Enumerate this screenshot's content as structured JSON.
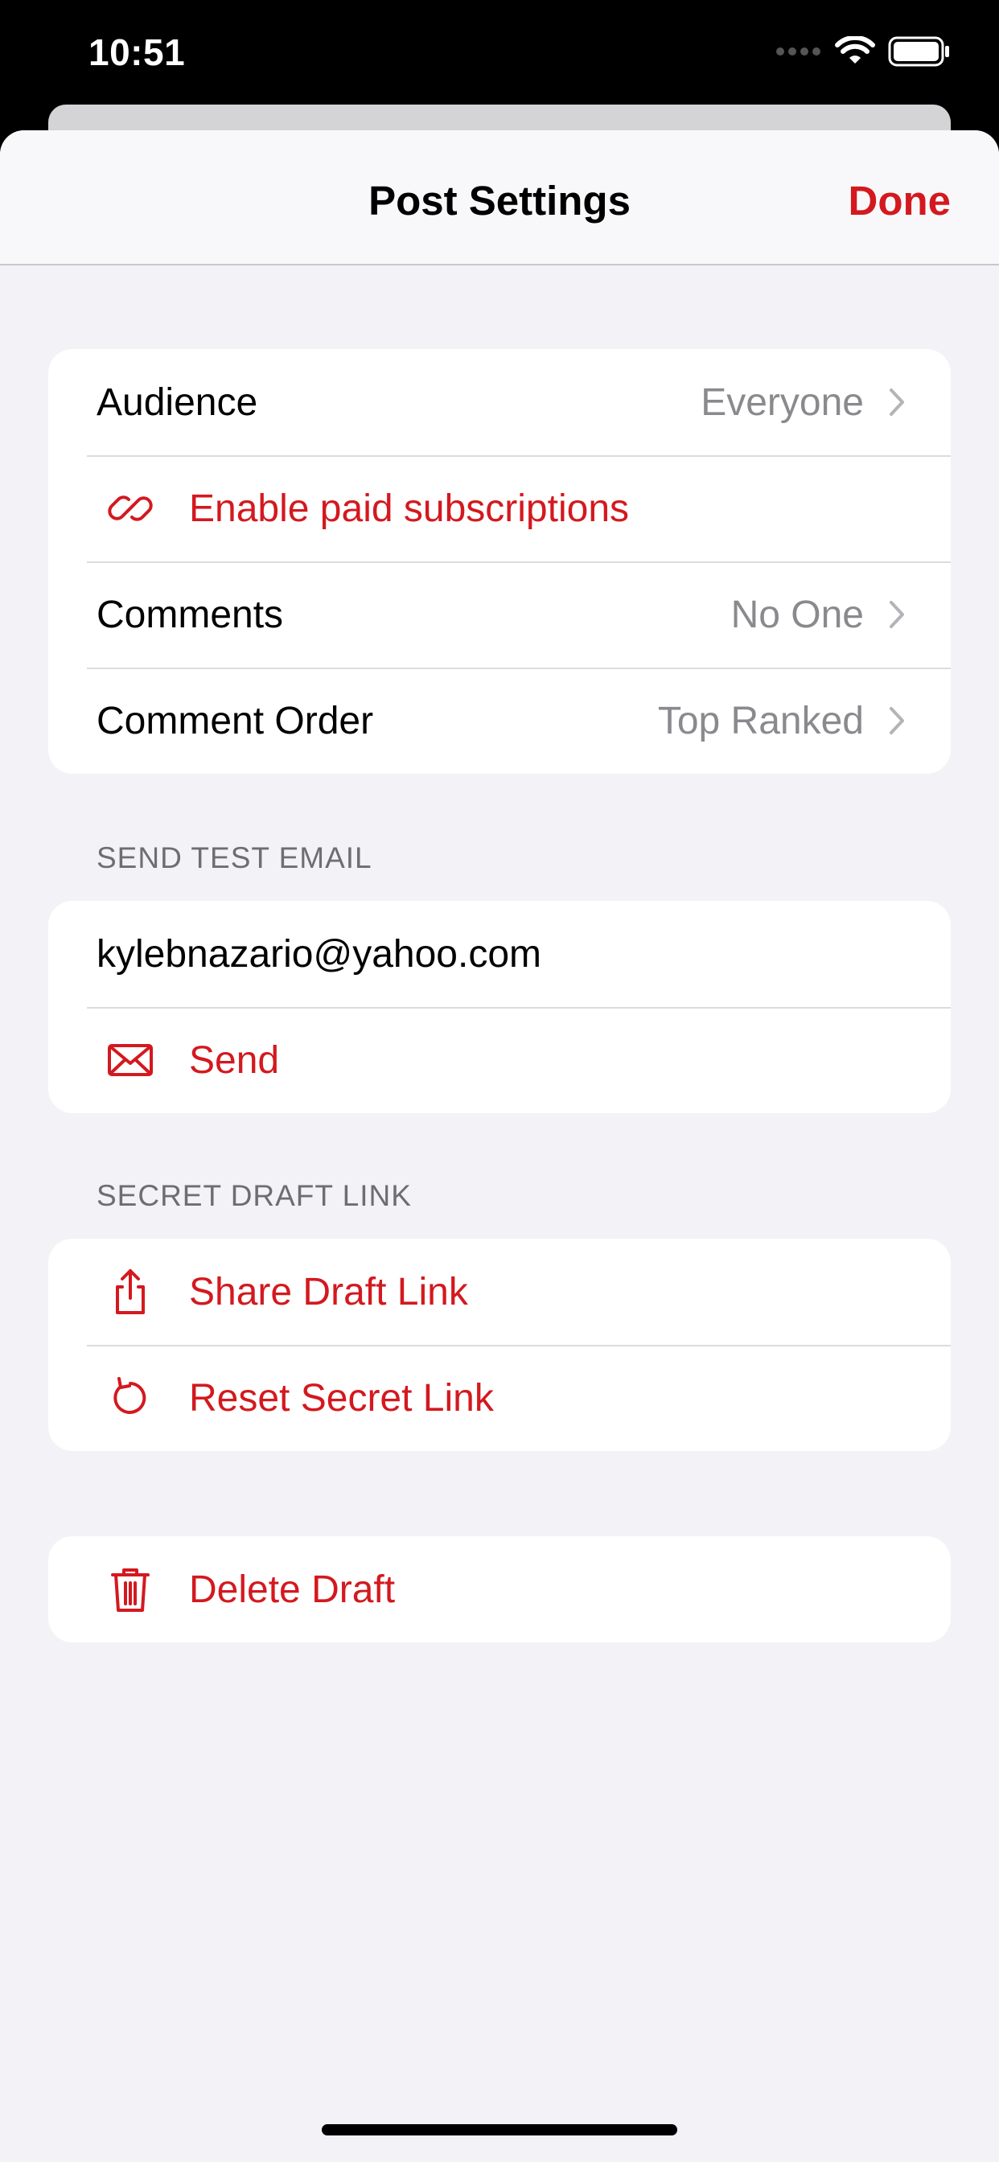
{
  "status_bar": {
    "time": "10:51"
  },
  "nav": {
    "title": "Post Settings",
    "done_label": "Done"
  },
  "settings": {
    "audience": {
      "label": "Audience",
      "value": "Everyone"
    },
    "paid": {
      "label": "Enable paid subscriptions"
    },
    "comments": {
      "label": "Comments",
      "value": "No One"
    },
    "comment_order": {
      "label": "Comment Order",
      "value": "Top Ranked"
    }
  },
  "test_email": {
    "header": "SEND TEST EMAIL",
    "email_value": "kylebnazario@yahoo.com",
    "send_label": "Send"
  },
  "draft_link": {
    "header": "SECRET DRAFT LINK",
    "share_label": "Share Draft Link",
    "reset_label": "Reset Secret Link"
  },
  "danger": {
    "delete_label": "Delete Draft"
  },
  "colors": {
    "accent": "#d3191f",
    "background": "#f2f2f7",
    "secondary_text": "#8a8a8e"
  },
  "icons": [
    "wifi-icon",
    "battery-icon",
    "link-icon",
    "envelope-icon",
    "share-icon",
    "reset-icon",
    "trash-icon",
    "chevron-right-icon"
  ]
}
